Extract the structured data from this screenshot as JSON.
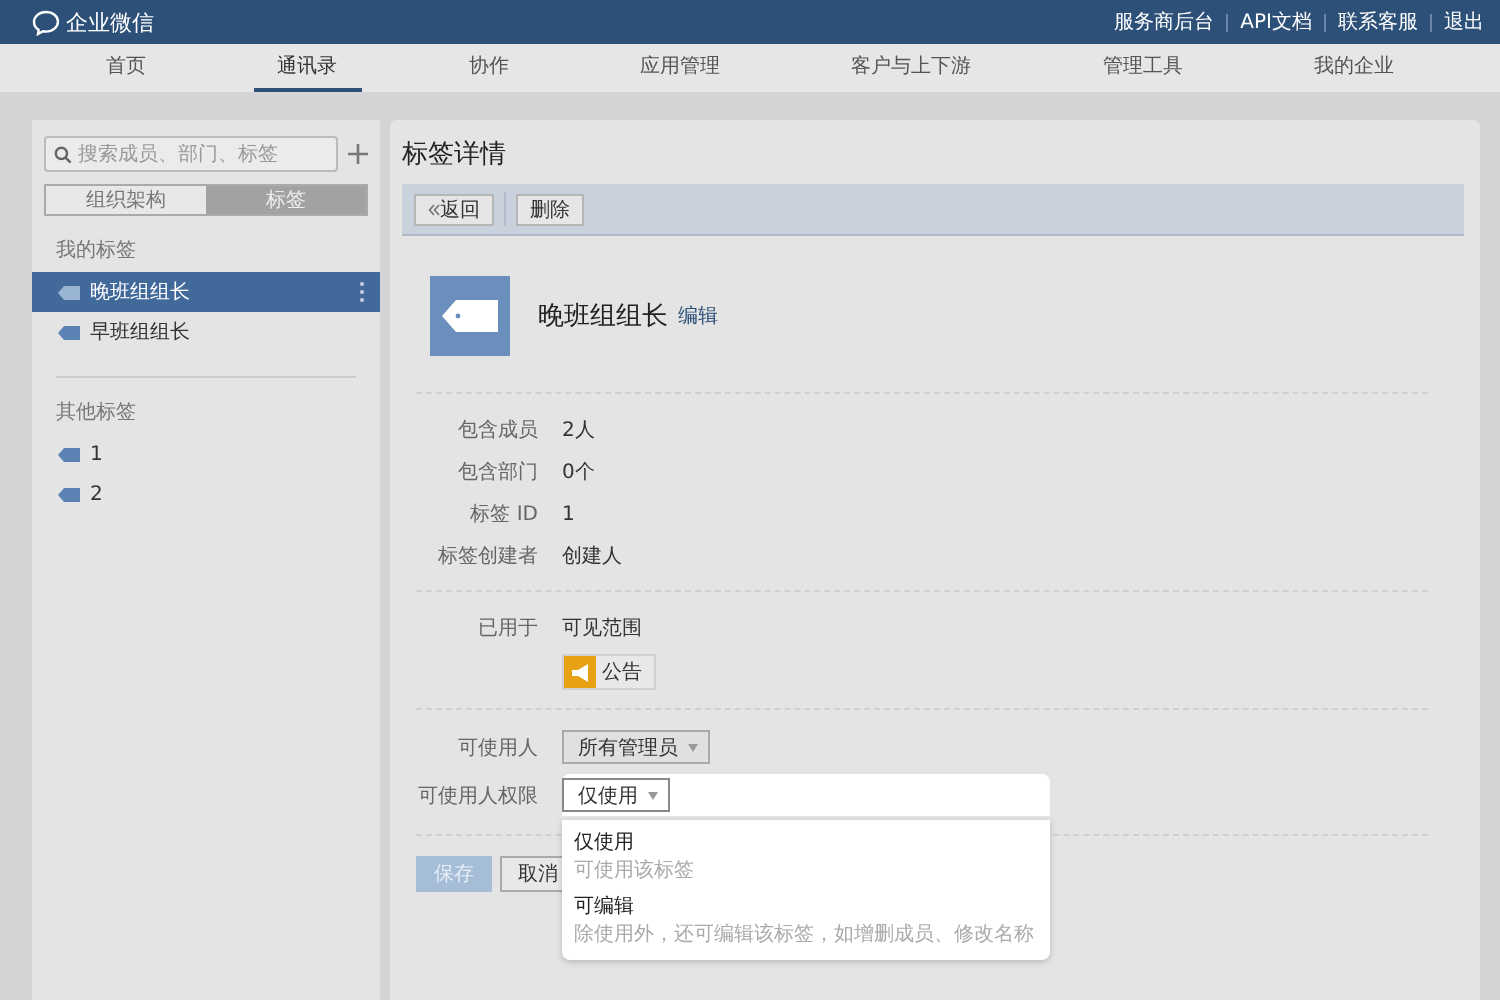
{
  "header": {
    "logo_text": "企业微信",
    "links": [
      "服务商后台",
      "API文档",
      "联系客服",
      "退出"
    ]
  },
  "nav": [
    {
      "label": "首页",
      "selected": false
    },
    {
      "label": "通讯录",
      "selected": true
    },
    {
      "label": "协作",
      "selected": false
    },
    {
      "label": "应用管理",
      "selected": false
    },
    {
      "label": "客户与上下游",
      "selected": false
    },
    {
      "label": "管理工具",
      "selected": false
    },
    {
      "label": "我的企业",
      "selected": false
    }
  ],
  "sidebar": {
    "search": {
      "placeholder": "搜索成员、部门、标签"
    },
    "segments": [
      {
        "label": "组织架构",
        "selected": false
      },
      {
        "label": "标签",
        "selected": true
      }
    ],
    "sections": [
      {
        "title": "我的标签",
        "items": [
          {
            "label": "晚班组组长",
            "selected": true
          },
          {
            "label": "早班组组长",
            "selected": false
          }
        ]
      },
      {
        "title": "其他标签",
        "items": [
          {
            "label": "1",
            "selected": false
          },
          {
            "label": "2",
            "selected": false
          }
        ]
      }
    ]
  },
  "detail": {
    "title": "标签详情",
    "toolbar": [
      {
        "label": "返回",
        "kind": "back"
      },
      {
        "label": "删除",
        "kind": "plain"
      }
    ],
    "tag_name": "晚班组组长",
    "edit_link": "编辑",
    "fields": [
      {
        "label": "包含成员",
        "value": "2人"
      },
      {
        "label": "包含部门",
        "value": "0个"
      },
      {
        "label": "标签 ID",
        "value": "1"
      },
      {
        "label": "标签创建者",
        "value": "创建人"
      }
    ],
    "used_in": {
      "label": "已用于",
      "value": "可见范围",
      "app": "公告"
    },
    "users": {
      "label": "可使用人",
      "value": "所有管理员"
    },
    "rights": {
      "label": "可使用人权限",
      "value": "仅使用",
      "expanded": true,
      "options": [
        {
          "title": "仅使用",
          "desc": "可使用该标签"
        },
        {
          "title": "可编辑",
          "desc": "除使用外，还可编辑该标签，如增删成员、修改名称"
        }
      ]
    },
    "actions": [
      {
        "label": "保存",
        "kind": "primary",
        "disabled": true
      },
      {
        "label": "取消",
        "kind": "plain",
        "disabled": false
      }
    ]
  }
}
